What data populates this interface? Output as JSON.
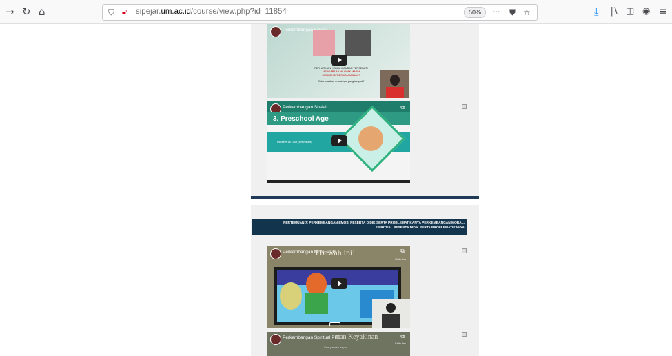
{
  "browser": {
    "url_prefix": "sipejar.",
    "url_domain": "um.ac.id",
    "url_path": "/course/view.php?id=11854",
    "zoom": "50%",
    "page_actions_label": "···",
    "icons": [
      "forward-icon",
      "reload-icon",
      "home-icon",
      "shield-icon",
      "insecure-lock-icon",
      "pocket-icon",
      "bookmark-star-icon",
      "download-icon",
      "library-icon",
      "sidebar-icon",
      "account-icon",
      "menu-icon"
    ]
  },
  "videos": [
    {
      "title": "Perkembangan Emosi",
      "line1": "PERHATIKAN KEDUA GAMBAR TERSEBUT!",
      "line2": "MENGAPA ANAK-ANAK MASIH",
      "line3": "MENGEKSPRESIKAN MARAH?",
      "question": "Coba jelaskan emosi apa yang tampak?"
    },
    {
      "title": "Perkembangan Sosial",
      "heading": "3. Preschool Age",
      "subtitle": "Initiative vs Guilt (berinisiatif)"
    },
    {
      "title": "Perkembangan Moral PPB",
      "overlay": "i bawah ini!",
      "share_label": "Salin link"
    },
    {
      "title": "Perkembangan Spiritual PPB",
      "overlay": "nan Keyakinan",
      "caption": "Saat pernah bayar",
      "share_label": "Salin link"
    }
  ],
  "banner": {
    "line1": "PERTEMUAN 7: PERKEMBANGAN EMOSI PESERTA DIDIK SERTA PROBLEMATIKANYA PERKEMBANGAN MORAL,",
    "line2": "SPIRITUAL PESERTA DIDIK SERTA PROBLEMATIKANYA"
  }
}
